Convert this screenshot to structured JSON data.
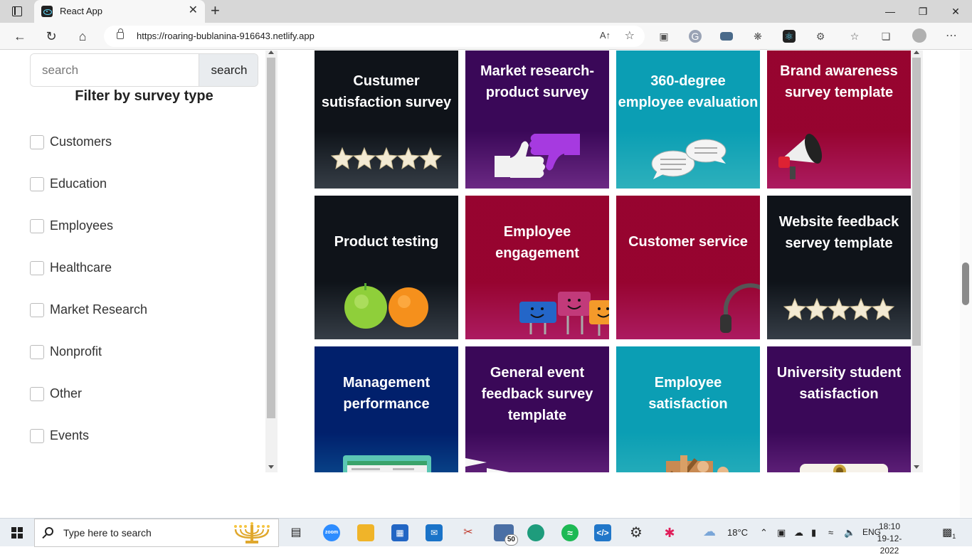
{
  "browser": {
    "tab_title": "React App",
    "tab_close": "✕",
    "new_tab": "+",
    "url": "https://roaring-bublanina-916643.netlify.app",
    "read_aloud": "A↑",
    "window_controls": [
      "—",
      "❐",
      "✕"
    ],
    "nav_icons": [
      "back-arrow-icon",
      "refresh-icon",
      "home-icon"
    ]
  },
  "sidebar": {
    "search_placeholder": "search",
    "search_button": "search",
    "filter_title": "Filter by survey type",
    "filters": [
      {
        "label": "Customers",
        "checked": false
      },
      {
        "label": "Education",
        "checked": false
      },
      {
        "label": "Employees",
        "checked": false
      },
      {
        "label": "Healthcare",
        "checked": false
      },
      {
        "label": "Market Research",
        "checked": false
      },
      {
        "label": "Nonprofit",
        "checked": false
      },
      {
        "label": "Other",
        "checked": false
      },
      {
        "label": "Events",
        "checked": false
      }
    ]
  },
  "surveys": [
    {
      "title": "Custumer sutisfaction survey",
      "color": "#3d4650",
      "art": "stars"
    },
    {
      "title": "Market research- product survey",
      "color": "#7a2e96",
      "art": "thumbs"
    },
    {
      "title": "360-degree employee evaluation",
      "color": "#34c9d6",
      "art": "speech-bubbles"
    },
    {
      "title": "Brand awareness survey template",
      "color": "#c41f6e",
      "art": "megaphone"
    },
    {
      "title": "Product testing",
      "color": "#3d4650",
      "art": "fruit"
    },
    {
      "title": "Employee engagement",
      "color": "#c41f6e",
      "art": "clips"
    },
    {
      "title": "Customer service",
      "color": "#c41f6e",
      "art": "headset"
    },
    {
      "title": "Website feedback servey template",
      "color": "#3d4650",
      "art": "stars"
    },
    {
      "title": "Management performance",
      "color": "#0c5aa6",
      "art": "laptop"
    },
    {
      "title": "General event feedback survey template",
      "color": "#7a2e96",
      "art": "planes"
    },
    {
      "title": "Employee satisfaction",
      "color": "#34c9d6",
      "art": "blocks"
    },
    {
      "title": "University student satisfaction",
      "color": "#7a2e96",
      "art": "diploma"
    }
  ],
  "taskbar": {
    "search_text": "Type here to search",
    "weather": "18°C",
    "language": "ENG",
    "time": "18:10",
    "date": "19-12-2022",
    "notification_count": "1",
    "store_badge": "50",
    "apps": [
      "task-view-icon",
      "zoom-icon",
      "file-explorer-icon",
      "store-icon",
      "mail-icon",
      "snipping-icon",
      "teams-icon",
      "edge-icon",
      "spotify-icon",
      "vscode-icon",
      "settings-icon",
      "slack-icon"
    ]
  }
}
